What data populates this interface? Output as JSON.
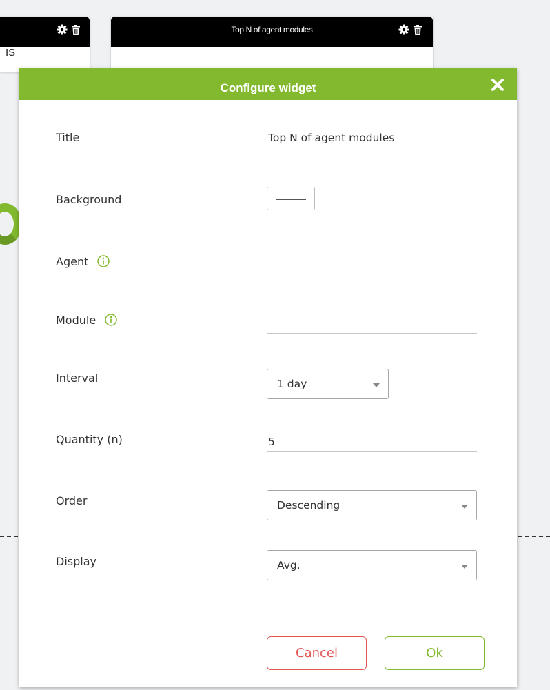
{
  "background": {
    "left_widget": {
      "text": "IS"
    },
    "right_widget": {
      "title": "Top N of agent modules"
    }
  },
  "colors": {
    "accent": "#82b92e",
    "cancel": "#e25555",
    "header_dark": "#000000",
    "page_bg": "#eff1f3"
  },
  "icons": {
    "widget_settings": "gear-icon",
    "widget_delete": "trash-icon",
    "close": "close-icon",
    "info": "info-icon"
  },
  "modal": {
    "title": "Configure widget",
    "fields": {
      "title_label": "Title",
      "title_value": "Top N of agent modules",
      "background_label": "Background",
      "agent_label": "Agent",
      "agent_value": "",
      "module_label": "Module",
      "module_value": "",
      "interval_label": "Interval",
      "interval_value": "1 day",
      "quantity_label": "Quantity (n)",
      "quantity_value": "5",
      "order_label": "Order",
      "order_value": "Descending",
      "display_label": "Display",
      "display_value": "Avg."
    },
    "buttons": {
      "cancel": "Cancel",
      "ok": "Ok"
    }
  }
}
